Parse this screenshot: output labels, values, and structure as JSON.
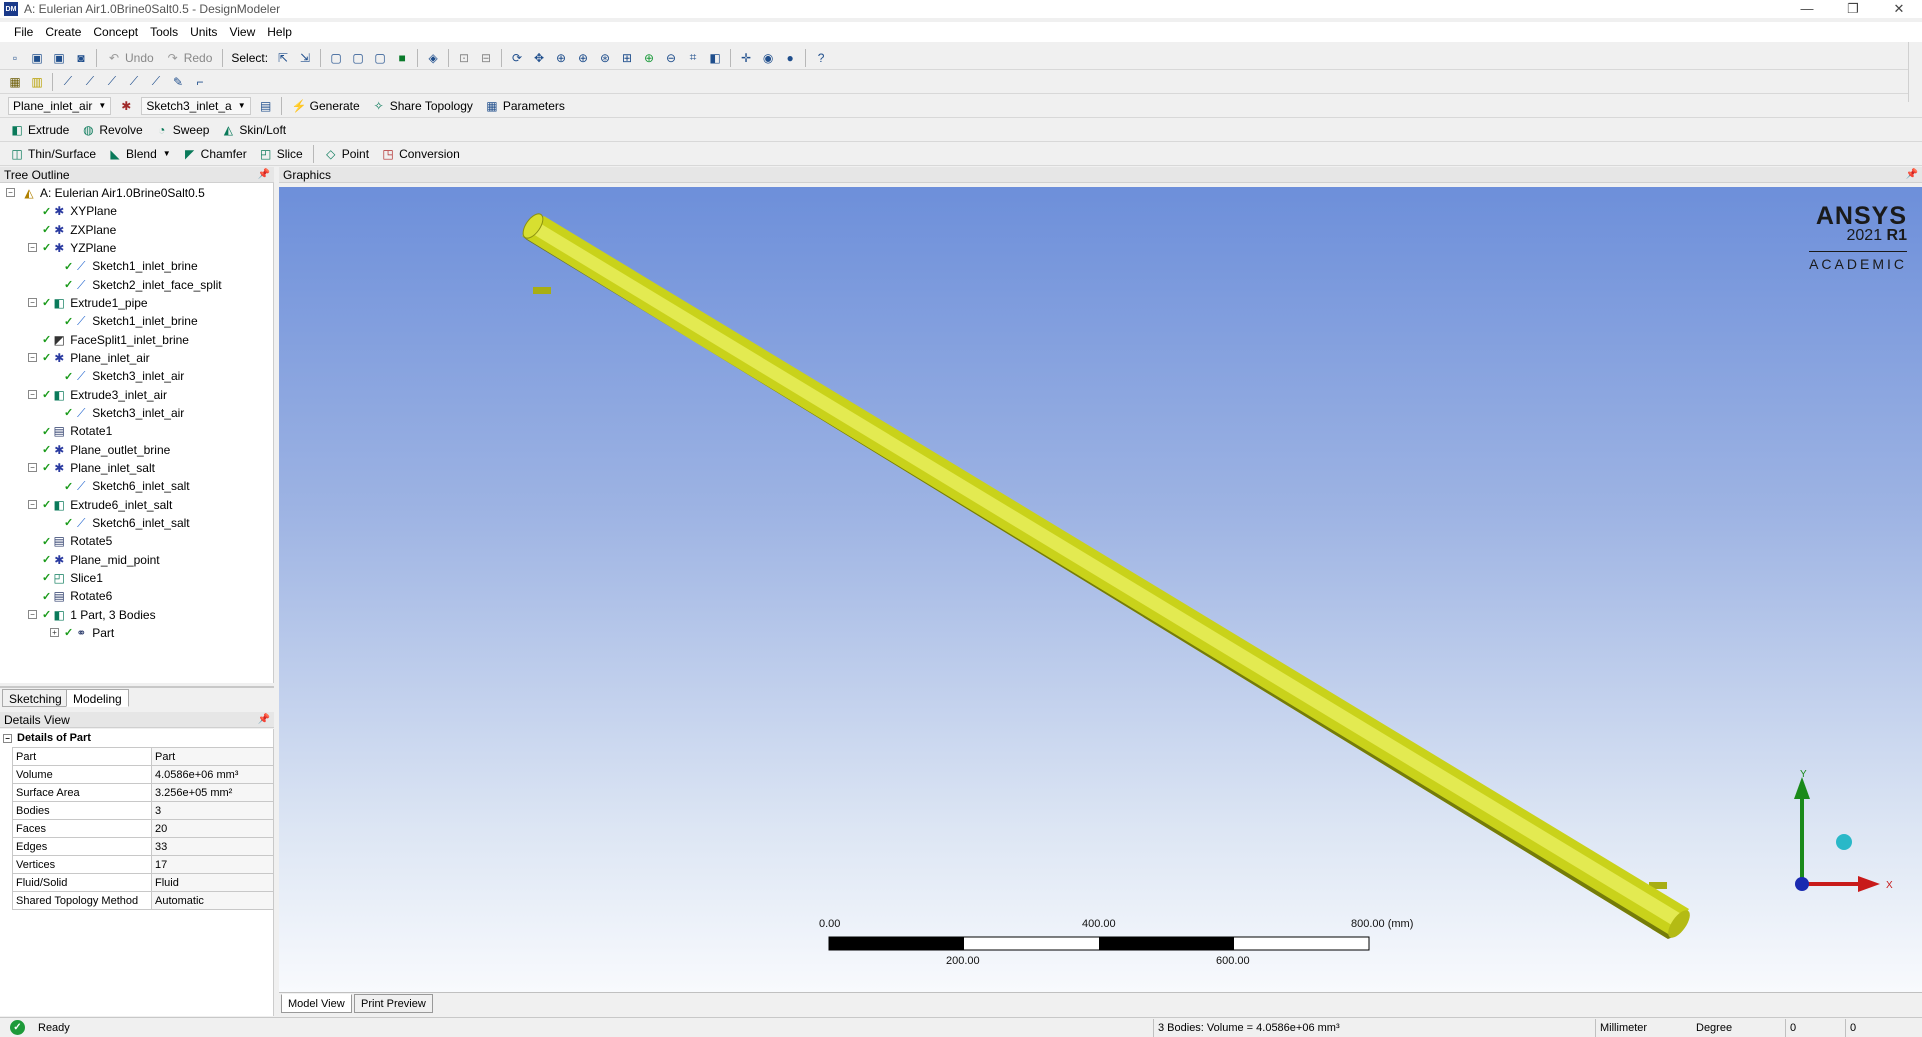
{
  "window": {
    "title": "A: Eulerian Air1.0Brine0Salt0.5 - DesignModeler",
    "icon_text": "DM",
    "controls": {
      "minimize": "—",
      "maximize": "❐",
      "close": "✕"
    }
  },
  "menu": [
    "File",
    "Create",
    "Concept",
    "Tools",
    "Units",
    "View",
    "Help"
  ],
  "toolbar1": {
    "undo": "Undo",
    "redo": "Redo",
    "select": "Select:"
  },
  "toolbar3": {
    "plane_combo": "Plane_inlet_air",
    "sketch_combo": "Sketch3_inlet_a",
    "generate": "Generate",
    "share_topology": "Share Topology",
    "parameters": "Parameters"
  },
  "toolbar4": {
    "extrude": "Extrude",
    "revolve": "Revolve",
    "sweep": "Sweep",
    "skin_loft": "Skin/Loft"
  },
  "toolbar5": {
    "thin_surface": "Thin/Surface",
    "blend": "Blend",
    "chamfer": "Chamfer",
    "slice": "Slice",
    "point": "Point",
    "conversion": "Conversion"
  },
  "tree": {
    "header": "Tree Outline",
    "items": [
      {
        "label": "A: Eulerian Air1.0Brine0Salt0.5",
        "icon": "root-icon",
        "depth": 0,
        "expander": "−",
        "check": false
      },
      {
        "label": "XYPlane",
        "icon": "plane-icon",
        "depth": 1,
        "expander": "",
        "check": true
      },
      {
        "label": "ZXPlane",
        "icon": "plane-icon",
        "depth": 1,
        "expander": "",
        "check": true
      },
      {
        "label": "YZPlane",
        "icon": "plane-icon",
        "depth": 1,
        "expander": "−",
        "check": true
      },
      {
        "label": "Sketch1_inlet_brine",
        "icon": "sketch-icon",
        "depth": 2,
        "expander": "",
        "check": true
      },
      {
        "label": "Sketch2_inlet_face_split",
        "icon": "sketch-icon",
        "depth": 2,
        "expander": "",
        "check": true
      },
      {
        "label": "Extrude1_pipe",
        "icon": "extrude-icon",
        "depth": 1,
        "expander": "−",
        "check": true
      },
      {
        "label": "Sketch1_inlet_brine",
        "icon": "sketch-icon",
        "depth": 2,
        "expander": "",
        "check": true
      },
      {
        "label": "FaceSplit1_inlet_brine",
        "icon": "facesplit-icon",
        "depth": 1,
        "expander": "",
        "check": true
      },
      {
        "label": "Plane_inlet_air",
        "icon": "plane-icon",
        "depth": 1,
        "expander": "−",
        "check": true
      },
      {
        "label": "Sketch3_inlet_air",
        "icon": "sketch-icon",
        "depth": 2,
        "expander": "",
        "check": true
      },
      {
        "label": "Extrude3_inlet_air",
        "icon": "extrude-icon",
        "depth": 1,
        "expander": "−",
        "check": true
      },
      {
        "label": "Sketch3_inlet_air",
        "icon": "sketch-icon",
        "depth": 2,
        "expander": "",
        "check": true
      },
      {
        "label": "Rotate1",
        "icon": "rotate-icon",
        "depth": 1,
        "expander": "",
        "check": true
      },
      {
        "label": "Plane_outlet_brine",
        "icon": "plane-icon",
        "depth": 1,
        "expander": "",
        "check": true
      },
      {
        "label": "Plane_inlet_salt",
        "icon": "plane-icon",
        "depth": 1,
        "expander": "−",
        "check": true
      },
      {
        "label": "Sketch6_inlet_salt",
        "icon": "sketch-icon",
        "depth": 2,
        "expander": "",
        "check": true
      },
      {
        "label": "Extrude6_inlet_salt",
        "icon": "extrude-icon",
        "depth": 1,
        "expander": "−",
        "check": true
      },
      {
        "label": "Sketch6_inlet_salt",
        "icon": "sketch-icon",
        "depth": 2,
        "expander": "",
        "check": true
      },
      {
        "label": "Rotate5",
        "icon": "rotate-icon",
        "depth": 1,
        "expander": "",
        "check": true
      },
      {
        "label": "Plane_mid_point",
        "icon": "plane-icon",
        "depth": 1,
        "expander": "",
        "check": true
      },
      {
        "label": "Slice1",
        "icon": "slice-icon",
        "depth": 1,
        "expander": "",
        "check": true
      },
      {
        "label": "Rotate6",
        "icon": "rotate-icon",
        "depth": 1,
        "expander": "",
        "check": true
      },
      {
        "label": "1 Part, 3 Bodies",
        "icon": "parts-icon",
        "depth": 1,
        "expander": "−",
        "check": true
      },
      {
        "label": "Part",
        "icon": "part-icon",
        "depth": 2,
        "expander": "+",
        "check": true
      }
    ]
  },
  "mode_tabs": {
    "sketching": "Sketching",
    "modeling": "Modeling"
  },
  "details": {
    "header": "Details View",
    "group": "Details of Part",
    "rows": [
      {
        "key": "Part",
        "value": "Part"
      },
      {
        "key": "Volume",
        "value": "4.0586e+06 mm³"
      },
      {
        "key": "Surface Area",
        "value": "3.256e+05 mm²"
      },
      {
        "key": "Bodies",
        "value": "3"
      },
      {
        "key": "Faces",
        "value": "20"
      },
      {
        "key": "Edges",
        "value": "33"
      },
      {
        "key": "Vertices",
        "value": "17"
      },
      {
        "key": "Fluid/Solid",
        "value": "Fluid"
      },
      {
        "key": "Shared Topology Method",
        "value": "Automatic"
      }
    ]
  },
  "graphics": {
    "header": "Graphics",
    "brand": {
      "name": "ANSYS",
      "year": "2021",
      "release": "R1",
      "edition": "ACADEMIC"
    },
    "pipe_color": "#c9d21a",
    "scale": {
      "top_labels": [
        "0.00",
        "400.00",
        "800.00 (mm)"
      ],
      "bottom_labels": [
        "200.00",
        "600.00"
      ]
    },
    "triad": {
      "y": "Y",
      "x": "X"
    }
  },
  "view_tabs": {
    "model_view": "Model View",
    "print_preview": "Print Preview"
  },
  "status": {
    "ready": "Ready",
    "selection": "3 Bodies: Volume = 4.0586e+06 mm³",
    "units_length": "Millimeter",
    "units_angle": "Degree",
    "field1": "0",
    "field2": "0"
  }
}
